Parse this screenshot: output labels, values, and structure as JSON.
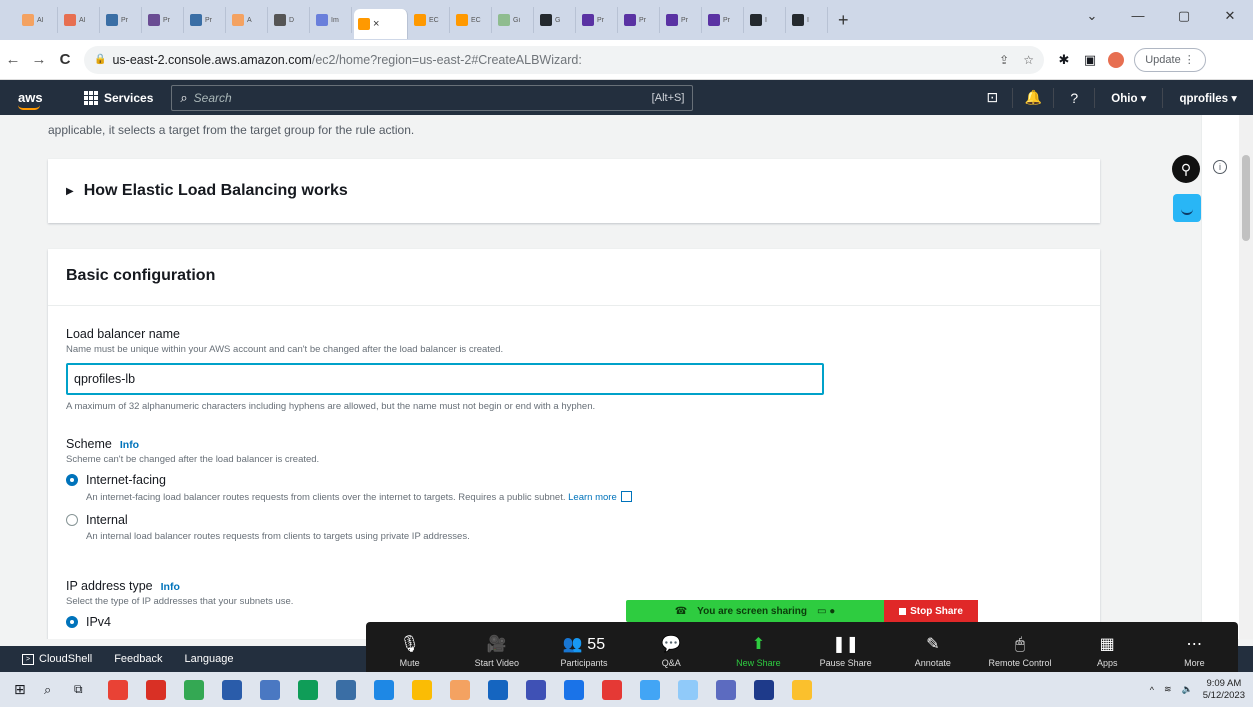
{
  "browser": {
    "tabs": [
      {
        "label": "Al",
        "color": "#f4a261"
      },
      {
        "label": "Al",
        "color": "#e76f51"
      },
      {
        "label": "Pr",
        "color": "#3a6ea5"
      },
      {
        "label": "Pr",
        "color": "#6a4c93"
      },
      {
        "label": "Pr",
        "color": "#3a6ea5"
      },
      {
        "label": "A",
        "color": "#f4a261"
      },
      {
        "label": "D",
        "color": "#555555"
      },
      {
        "label": "Im",
        "color": "#6a7fdb"
      }
    ],
    "active_tab": {
      "label": "",
      "color": "#ff9900",
      "close": "×"
    },
    "tabs_right": [
      {
        "label": "EC",
        "color": "#ff9900"
      },
      {
        "label": "EC",
        "color": "#ff9900"
      },
      {
        "label": "Gi",
        "color": "#8fbc8f"
      },
      {
        "label": "G",
        "color": "#24292e"
      },
      {
        "label": "Pr",
        "color": "#5a32a3"
      },
      {
        "label": "Pr",
        "color": "#5a32a3"
      },
      {
        "label": "Pr",
        "color": "#5a32a3"
      },
      {
        "label": "Pr",
        "color": "#5a32a3"
      },
      {
        "label": "I",
        "color": "#24292e"
      },
      {
        "label": "I",
        "color": "#24292e"
      }
    ],
    "new_tab": "+",
    "window_controls": [
      "⌄",
      "—",
      "▢",
      "✕"
    ],
    "url_host": "us-east-2.console.aws.amazon.com",
    "url_path": "/ec2/home?region=us-east-2#CreateALBWizard:",
    "update_label": "Update"
  },
  "aws_nav": {
    "logo": "aws",
    "services": "Services",
    "search_placeholder": "Search",
    "search_shortcut": "[Alt+S]",
    "region": "Ohio ▾",
    "account": "qprofiles ▾"
  },
  "content": {
    "cut_text": "applicable, it selects a target from the target group for the rule action.",
    "how_panel": "How Elastic Load Balancing works",
    "basic_title": "Basic configuration",
    "lb_name_label": "Load balancer name",
    "lb_name_desc": "Name must be unique within your AWS account and can't be changed after the load balancer is created.",
    "lb_name_value": "qprofiles-lb",
    "lb_name_constraint": "A maximum of 32 alphanumeric characters including hyphens are allowed, but the name must not begin or end with a hyphen.",
    "scheme_label": "Scheme",
    "info": "Info",
    "scheme_desc": "Scheme can't be changed after the load balancer is created.",
    "internet_facing": "Internet-facing",
    "internet_facing_desc": "An internet-facing load balancer routes requests from clients over the internet to targets. Requires a public subnet.",
    "learn_more": "Learn more",
    "internal": "Internal",
    "internal_desc": "An internal load balancer routes requests from clients to targets using private IP addresses.",
    "ip_type_label": "IP address type",
    "ip_type_desc": "Select the type of IP addresses that your subnets use.",
    "ipv4": "IPv4"
  },
  "aws_footer": {
    "cloudshell": "CloudShell",
    "feedback": "Feedback",
    "language": "Language"
  },
  "sharing": {
    "status": "You are screen sharing",
    "stop": "Stop Share"
  },
  "zoom": {
    "items": [
      {
        "label": "Mute",
        "icon": "🎙"
      },
      {
        "label": "Start Video",
        "icon": "🎥"
      },
      {
        "label": "Participants",
        "icon": "👥 55"
      },
      {
        "label": "Q&A",
        "icon": "💬"
      },
      {
        "label": "New Share",
        "icon": "⬆"
      },
      {
        "label": "Pause Share",
        "icon": "❚❚"
      },
      {
        "label": "Annotate",
        "icon": "✎"
      },
      {
        "label": "Remote Control",
        "icon": "🖱"
      },
      {
        "label": "Apps",
        "icon": "▦"
      },
      {
        "label": "More",
        "icon": "⋯"
      }
    ]
  },
  "taskbar": {
    "clock_time": "9:09 AM",
    "clock_date": "5/12/2023"
  }
}
